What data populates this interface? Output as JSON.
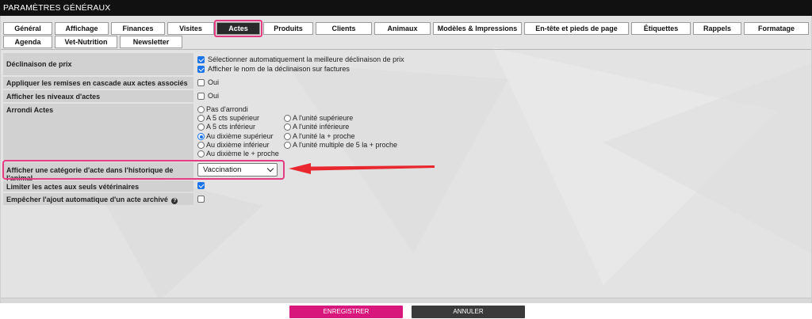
{
  "title": "PARAMÈTRES GÉNÉRAUX",
  "tabs_row1": [
    "Général",
    "Affichage",
    "Finances",
    "Visites",
    "Actes",
    "Produits",
    "Clients",
    "Animaux",
    "Modèles & Impressions",
    "En-tête et pieds de page",
    "Étiquettes",
    "Rappels",
    "Formatage"
  ],
  "tabs_row2": [
    "Agenda",
    "Vet-Nutrition",
    "Newsletter"
  ],
  "active_tab": "Actes",
  "settings": {
    "declinaison_label": "Déclinaison de prix",
    "declinaison_opt1": "Sélectionner automatiquement la meilleure déclinaison de prix",
    "declinaison_opt2": "Afficher le nom de la déclinaison sur factures",
    "remises_label": "Appliquer les remises en cascade aux actes associés",
    "remises_value": "Oui",
    "niveaux_label": "Afficher les niveaux d'actes",
    "niveaux_value": "Oui",
    "arrondi_label": "Arrondi Actes",
    "arrondi_options": [
      "Pas d'arrondi",
      "A 5 cts supérieur",
      "A l'unité supérieure",
      "A 5 cts inférieur",
      "A l'unité inférieure",
      "Au dixième supérieur",
      "A l'unité la + proche",
      "Au dixième inférieur",
      "A l'unité multiple de 5 la + proche",
      "Au dixième le + proche"
    ],
    "arrondi_selected": "Au dixième supérieur",
    "categorie_label": "Afficher une catégorie d'acte dans l'historique de l'animal",
    "categorie_value": "Vaccination",
    "limiter_label": "Limiter les actes aux seuls vétérinaires",
    "empecher_label": "Empêcher l'ajout automatique d'un acte archivé",
    "help_glyph": "?"
  },
  "checkbox_state": {
    "declinaison_opt1": true,
    "declinaison_opt2": true,
    "remises": false,
    "niveaux": false,
    "limiter": true,
    "empecher": false
  },
  "buttons": {
    "save": "ENREGISTRER",
    "cancel": "ANNULER"
  },
  "colors": {
    "highlight": "#e63b83",
    "save_button": "#d7177c",
    "cancel_button": "#3a3a3a",
    "arrow": "#e8282e",
    "checkbox": "#1a73e8"
  }
}
